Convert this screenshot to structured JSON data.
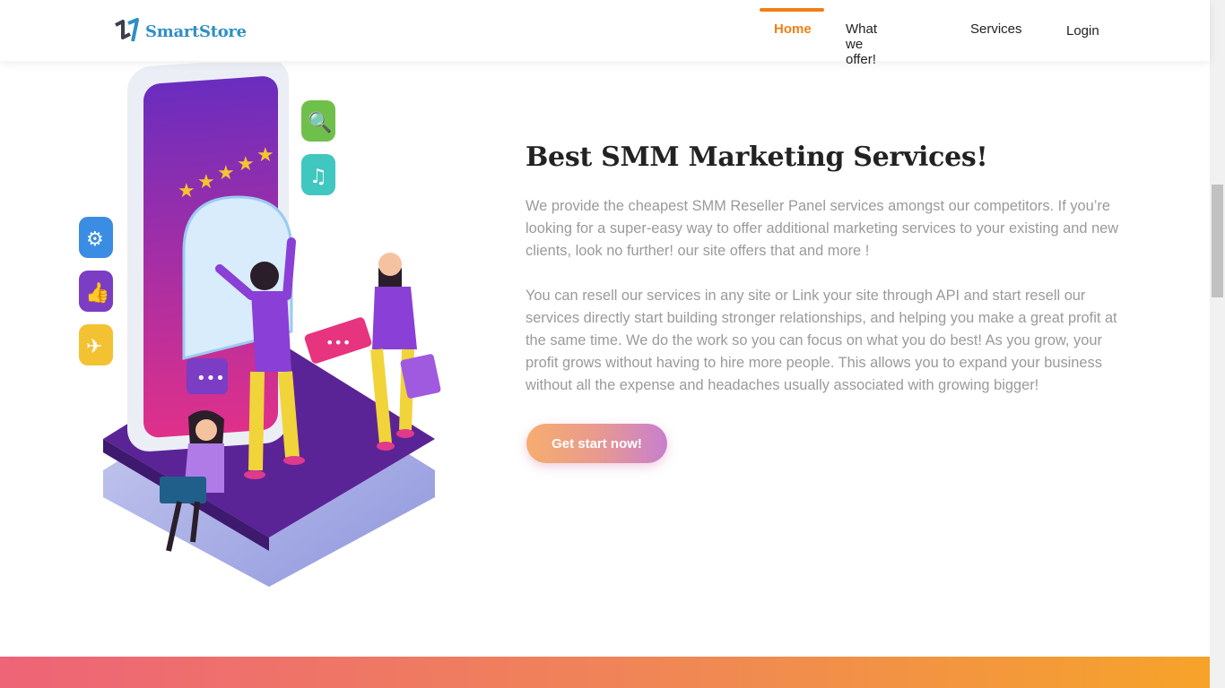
{
  "brand": {
    "name": "SmartStore"
  },
  "nav": {
    "items": [
      {
        "label": "Home",
        "active": true
      },
      {
        "label": "What we offer!",
        "active": false
      },
      {
        "label": "Services",
        "active": false
      },
      {
        "label": "Login",
        "active": false
      }
    ]
  },
  "hero": {
    "title": "Best SMM Marketing Services!",
    "paragraph1": "We provide the cheapest SMM Reseller Panel services amongst our competitors. If you’re looking for a super-easy way to offer additional marketing services to your existing and new clients, look no further! our site offers that and more !",
    "paragraph2": "You can resell our services in any site or Link your site through API and start resell our services directly start building stronger relationships, and helping you make a great profit at the same time. We do the work so you can focus on what you do best! As you grow, your profit grows without having to hire more people. This allows you to expand your business without all the expense and headaches usually associated with growing bigger!",
    "cta_label": "Get start now!"
  },
  "colors": {
    "accent": "#f08015",
    "brand_blue": "#2f8fc4",
    "text_dark": "#222222",
    "text_muted": "#9a9a9a",
    "purple": "#6a2c9e",
    "magenta": "#e0308a",
    "footer_gradient_start": "#ee6478",
    "footer_gradient_end": "#f6a32a"
  },
  "icons": [
    "logo-icon",
    "search-icon",
    "music-icon",
    "gear-icon",
    "thumbs-up-icon",
    "airplane-icon",
    "star-icon",
    "chat-bubble-icon",
    "laptop-icon"
  ]
}
